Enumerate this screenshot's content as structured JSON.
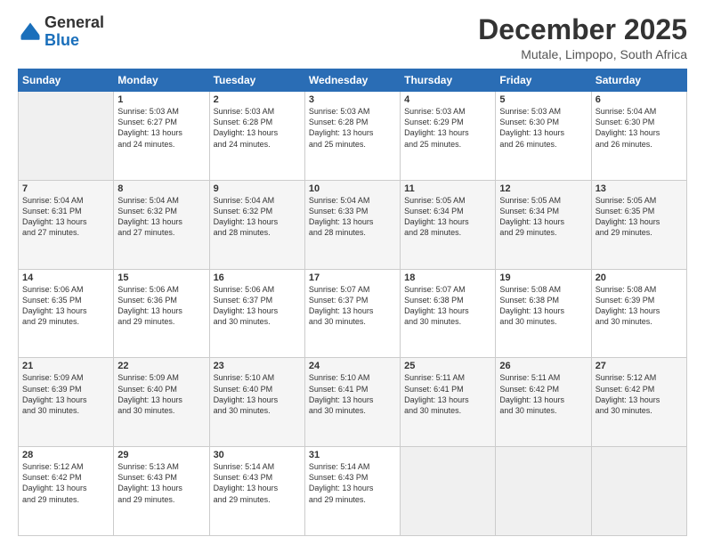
{
  "header": {
    "logo_line1": "General",
    "logo_line2": "Blue",
    "month_title": "December 2025",
    "location": "Mutale, Limpopo, South Africa"
  },
  "days_of_week": [
    "Sunday",
    "Monday",
    "Tuesday",
    "Wednesday",
    "Thursday",
    "Friday",
    "Saturday"
  ],
  "weeks": [
    [
      {
        "num": "",
        "info": ""
      },
      {
        "num": "1",
        "info": "Sunrise: 5:03 AM\nSunset: 6:27 PM\nDaylight: 13 hours\nand 24 minutes."
      },
      {
        "num": "2",
        "info": "Sunrise: 5:03 AM\nSunset: 6:28 PM\nDaylight: 13 hours\nand 24 minutes."
      },
      {
        "num": "3",
        "info": "Sunrise: 5:03 AM\nSunset: 6:28 PM\nDaylight: 13 hours\nand 25 minutes."
      },
      {
        "num": "4",
        "info": "Sunrise: 5:03 AM\nSunset: 6:29 PM\nDaylight: 13 hours\nand 25 minutes."
      },
      {
        "num": "5",
        "info": "Sunrise: 5:03 AM\nSunset: 6:30 PM\nDaylight: 13 hours\nand 26 minutes."
      },
      {
        "num": "6",
        "info": "Sunrise: 5:04 AM\nSunset: 6:30 PM\nDaylight: 13 hours\nand 26 minutes."
      }
    ],
    [
      {
        "num": "7",
        "info": "Sunrise: 5:04 AM\nSunset: 6:31 PM\nDaylight: 13 hours\nand 27 minutes."
      },
      {
        "num": "8",
        "info": "Sunrise: 5:04 AM\nSunset: 6:32 PM\nDaylight: 13 hours\nand 27 minutes."
      },
      {
        "num": "9",
        "info": "Sunrise: 5:04 AM\nSunset: 6:32 PM\nDaylight: 13 hours\nand 28 minutes."
      },
      {
        "num": "10",
        "info": "Sunrise: 5:04 AM\nSunset: 6:33 PM\nDaylight: 13 hours\nand 28 minutes."
      },
      {
        "num": "11",
        "info": "Sunrise: 5:05 AM\nSunset: 6:34 PM\nDaylight: 13 hours\nand 28 minutes."
      },
      {
        "num": "12",
        "info": "Sunrise: 5:05 AM\nSunset: 6:34 PM\nDaylight: 13 hours\nand 29 minutes."
      },
      {
        "num": "13",
        "info": "Sunrise: 5:05 AM\nSunset: 6:35 PM\nDaylight: 13 hours\nand 29 minutes."
      }
    ],
    [
      {
        "num": "14",
        "info": "Sunrise: 5:06 AM\nSunset: 6:35 PM\nDaylight: 13 hours\nand 29 minutes."
      },
      {
        "num": "15",
        "info": "Sunrise: 5:06 AM\nSunset: 6:36 PM\nDaylight: 13 hours\nand 29 minutes."
      },
      {
        "num": "16",
        "info": "Sunrise: 5:06 AM\nSunset: 6:37 PM\nDaylight: 13 hours\nand 30 minutes."
      },
      {
        "num": "17",
        "info": "Sunrise: 5:07 AM\nSunset: 6:37 PM\nDaylight: 13 hours\nand 30 minutes."
      },
      {
        "num": "18",
        "info": "Sunrise: 5:07 AM\nSunset: 6:38 PM\nDaylight: 13 hours\nand 30 minutes."
      },
      {
        "num": "19",
        "info": "Sunrise: 5:08 AM\nSunset: 6:38 PM\nDaylight: 13 hours\nand 30 minutes."
      },
      {
        "num": "20",
        "info": "Sunrise: 5:08 AM\nSunset: 6:39 PM\nDaylight: 13 hours\nand 30 minutes."
      }
    ],
    [
      {
        "num": "21",
        "info": "Sunrise: 5:09 AM\nSunset: 6:39 PM\nDaylight: 13 hours\nand 30 minutes."
      },
      {
        "num": "22",
        "info": "Sunrise: 5:09 AM\nSunset: 6:40 PM\nDaylight: 13 hours\nand 30 minutes."
      },
      {
        "num": "23",
        "info": "Sunrise: 5:10 AM\nSunset: 6:40 PM\nDaylight: 13 hours\nand 30 minutes."
      },
      {
        "num": "24",
        "info": "Sunrise: 5:10 AM\nSunset: 6:41 PM\nDaylight: 13 hours\nand 30 minutes."
      },
      {
        "num": "25",
        "info": "Sunrise: 5:11 AM\nSunset: 6:41 PM\nDaylight: 13 hours\nand 30 minutes."
      },
      {
        "num": "26",
        "info": "Sunrise: 5:11 AM\nSunset: 6:42 PM\nDaylight: 13 hours\nand 30 minutes."
      },
      {
        "num": "27",
        "info": "Sunrise: 5:12 AM\nSunset: 6:42 PM\nDaylight: 13 hours\nand 30 minutes."
      }
    ],
    [
      {
        "num": "28",
        "info": "Sunrise: 5:12 AM\nSunset: 6:42 PM\nDaylight: 13 hours\nand 29 minutes."
      },
      {
        "num": "29",
        "info": "Sunrise: 5:13 AM\nSunset: 6:43 PM\nDaylight: 13 hours\nand 29 minutes."
      },
      {
        "num": "30",
        "info": "Sunrise: 5:14 AM\nSunset: 6:43 PM\nDaylight: 13 hours\nand 29 minutes."
      },
      {
        "num": "31",
        "info": "Sunrise: 5:14 AM\nSunset: 6:43 PM\nDaylight: 13 hours\nand 29 minutes."
      },
      {
        "num": "",
        "info": ""
      },
      {
        "num": "",
        "info": ""
      },
      {
        "num": "",
        "info": ""
      }
    ]
  ]
}
